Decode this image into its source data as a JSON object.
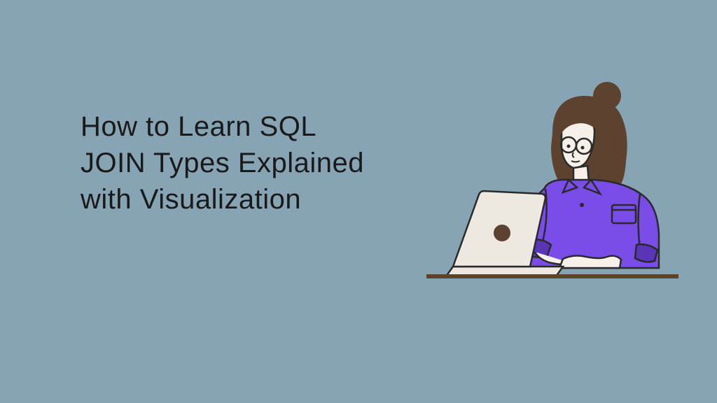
{
  "title": "How to Learn SQL JOIN Types Explained with Visualization",
  "illustration": {
    "description": "person-at-laptop",
    "colors": {
      "hair": "#5e4230",
      "skin": "#f7f0e8",
      "shirt": "#7a4ce8",
      "shirt_dark": "#5a35b8",
      "laptop": "#ede8e0",
      "desk": "#5e4230",
      "outline": "#2a2a2a"
    }
  }
}
